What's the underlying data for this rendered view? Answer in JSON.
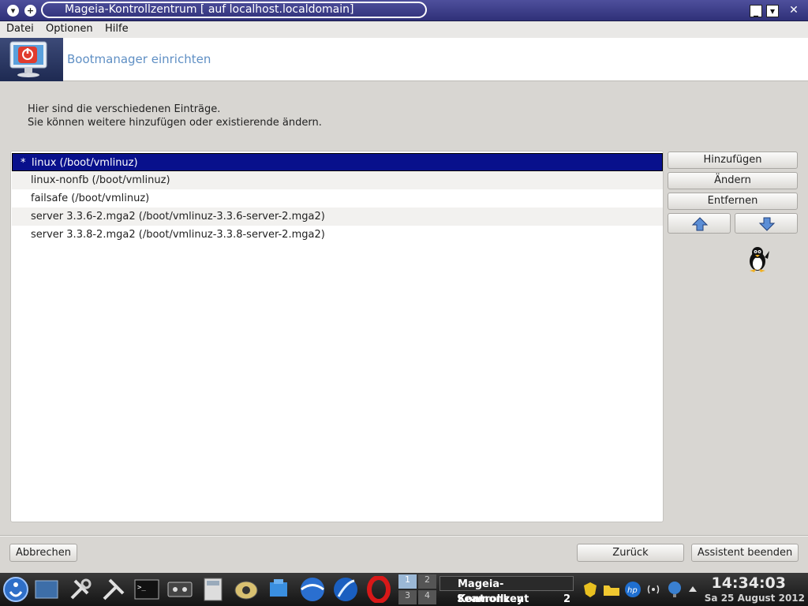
{
  "window": {
    "title": "Mageia-Kontrollzentrum  [ auf localhost.localdomain]"
  },
  "menubar": {
    "items": [
      {
        "label": "Datei"
      },
      {
        "label": "Optionen"
      },
      {
        "label": "Hilfe"
      }
    ]
  },
  "header": {
    "title": "Bootmanager einrichten",
    "icon": "power-monitor-icon"
  },
  "description": {
    "line1": "Hier sind die verschiedenen Einträge.",
    "line2": "Sie können weitere hinzufügen oder existierende ändern."
  },
  "entries": [
    {
      "label": "linux (/boot/vmlinuz)",
      "default": "*",
      "selected": true
    },
    {
      "label": "linux-nonfb (/boot/vmlinuz)"
    },
    {
      "label": "failsafe (/boot/vmlinuz)"
    },
    {
      "label": "server 3.3.6-2.mga2 (/boot/vmlinuz-3.3.6-server-2.mga2)"
    },
    {
      "label": "server 3.3.8-2.mga2 (/boot/vmlinuz-3.3.8-server-2.mga2)"
    }
  ],
  "buttons": {
    "add": "Hinzufügen",
    "modify": "Ändern",
    "remove": "Entfernen",
    "up_icon": "arrow-up-icon",
    "down_icon": "arrow-down-icon"
  },
  "footer": {
    "cancel": "Abbrechen",
    "back": "Zurück",
    "finish": "Assistent beenden"
  },
  "taskbar": {
    "tasks": [
      {
        "label": "Mageia-Kontrollzent"
      },
      {
        "label": "Seamonkey",
        "count": "2"
      }
    ],
    "pager": [
      "1",
      "2",
      "3",
      "4"
    ],
    "clock": "14:34:03",
    "date": "Sa 25 August 2012"
  },
  "colors": {
    "selection": "#08108c",
    "title_bar": "#3a3b86",
    "header_text": "#5f8fc4"
  }
}
